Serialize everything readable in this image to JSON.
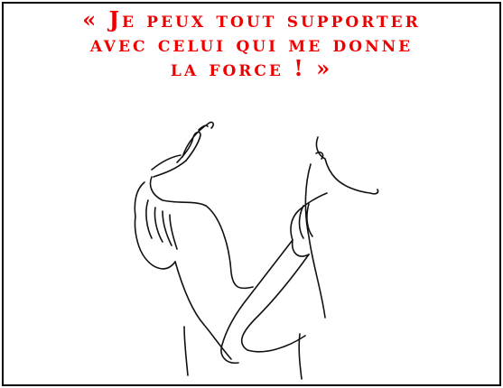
{
  "quote": {
    "lines": [
      "« Je peux tout supporter",
      "avec celui qui me donne",
      "la force ! »"
    ],
    "color": "#ee0000"
  },
  "illustration": {
    "icon": "embracing-figures-line-drawing"
  }
}
